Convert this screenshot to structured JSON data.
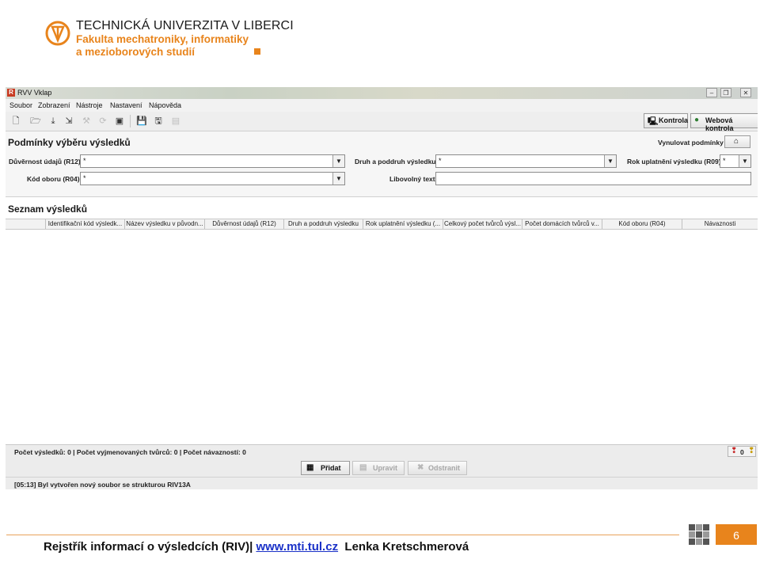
{
  "header": {
    "university": "TECHNICKÁ UNIVERZITA V LIBERCI",
    "faculty_line1": "Fakulta mechatroniky, informatiky",
    "faculty_line2": "a mezioborových studií"
  },
  "window": {
    "title": "RVV Vklap",
    "icon": "app-icon"
  },
  "menu": [
    "Soubor",
    "Zobrazení",
    "Nástroje",
    "Nastavení",
    "Nápověda"
  ],
  "toolbar": {
    "kontrola_label": "Kontrola",
    "web_kontrola_label": "Webová kontrola"
  },
  "conditions": {
    "title": "Podmínky výběru výsledků",
    "reset_label": "Vynulovat podmínky",
    "confidentiality_label": "Důvěrnost údajů (R12)",
    "confidentiality_value": "*",
    "type_label": "Druh a poddruh výsledku",
    "type_value": "*",
    "year_label": "Rok uplatnění výsledku (R09)",
    "year_value": "*",
    "field_label": "Kód oboru (R04)",
    "field_value": "*",
    "text_label": "Libovolný text",
    "text_value": ""
  },
  "results": {
    "title": "Seznam výsledků",
    "columns": [
      "Identifikační kód výsledk...",
      "Název výsledku v původn...",
      "Důvěrnost údajů (R12)",
      "Druh a poddruh výsledku",
      "Rok uplatnění výsledku (...",
      "Celkový počet tvůrců výsl...",
      "Počet domácích tvůrců v...",
      "Kód oboru (R04)",
      "Návaznosti"
    ]
  },
  "status": {
    "text": "Počet výsledků: 0  |  Počet vyjmenovaných tvůrců: 0  |  Počet návazností: 0",
    "counter1": "0"
  },
  "actions": {
    "add_label": "Přidat",
    "edit_label": "Upravit",
    "remove_label": "Odstranit"
  },
  "log": {
    "text": "[05:13] Byl vytvořen nový soubor se strukturou RIV13A"
  },
  "footer": {
    "text_before": "Rejstřík informací o výsledcích (RIV)|",
    "link": "www.mti.tul.cz",
    "author": "Lenka Kretschmerová",
    "page_number": "6"
  },
  "colors": {
    "accent": "#e8841c",
    "link": "#1a31c8"
  }
}
